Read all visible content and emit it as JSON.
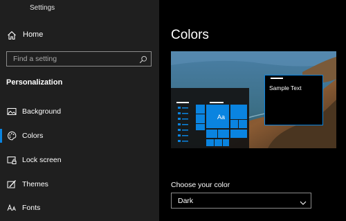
{
  "window": {
    "title": "Settings"
  },
  "sidebar": {
    "home_label": "Home",
    "search_placeholder": "Find a setting",
    "section_title": "Personalization",
    "items": [
      {
        "label": "Background",
        "icon": "picture-icon"
      },
      {
        "label": "Colors",
        "icon": "palette-icon",
        "selected": true
      },
      {
        "label": "Lock screen",
        "icon": "lock-screen-icon"
      },
      {
        "label": "Themes",
        "icon": "brush-icon"
      },
      {
        "label": "Fonts",
        "icon": "font-icon"
      }
    ]
  },
  "main": {
    "title": "Colors",
    "preview": {
      "sample_text": "Sample Text",
      "tile_label": "Aa"
    },
    "choose_color_label": "Choose your color",
    "choose_color_value": "Dark"
  },
  "colors": {
    "accent": "#0a84e0",
    "sidebar_bg": "#1f1f1f",
    "main_bg": "#000000"
  }
}
